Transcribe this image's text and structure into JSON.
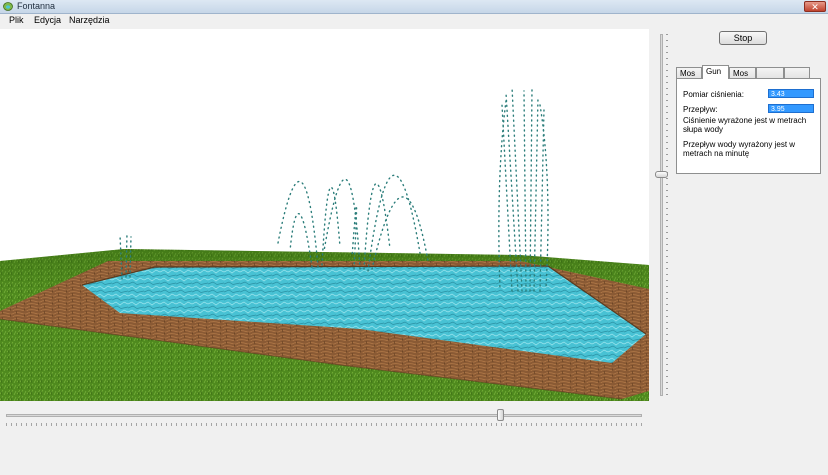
{
  "window": {
    "title": "Fontanna",
    "close_glyph": "✕"
  },
  "menu": {
    "items": [
      "Plik",
      "Edycja",
      "Narzędzia"
    ]
  },
  "controls": {
    "stop_label": "Stop",
    "tabs": [
      "Mos",
      "Gun",
      "Mos",
      "",
      ""
    ],
    "active_tab_index": 1,
    "pressure_label": "Pomiar ciśnienia:",
    "pressure_value": "3.43",
    "flow_label": "Przepływ:",
    "flow_value": "3.95",
    "note_pressure": "Ciśnienie wyrażone jest w metrach słupa wody",
    "note_flow": "Przepływ wody wyrażony jest w metrach na minutę"
  },
  "sliders": {
    "vertical_level": 0.38,
    "horizontal_level": 0.78
  },
  "icons": {
    "app": "fountain-app-icon",
    "close": "close-icon"
  },
  "colors": {
    "grass": "#4f8a1e",
    "water": "#4bc7d8",
    "stone": "#8a5a34",
    "droplets": "#2b7d7a",
    "selection": "#3399ff",
    "close": "#c0432e"
  }
}
